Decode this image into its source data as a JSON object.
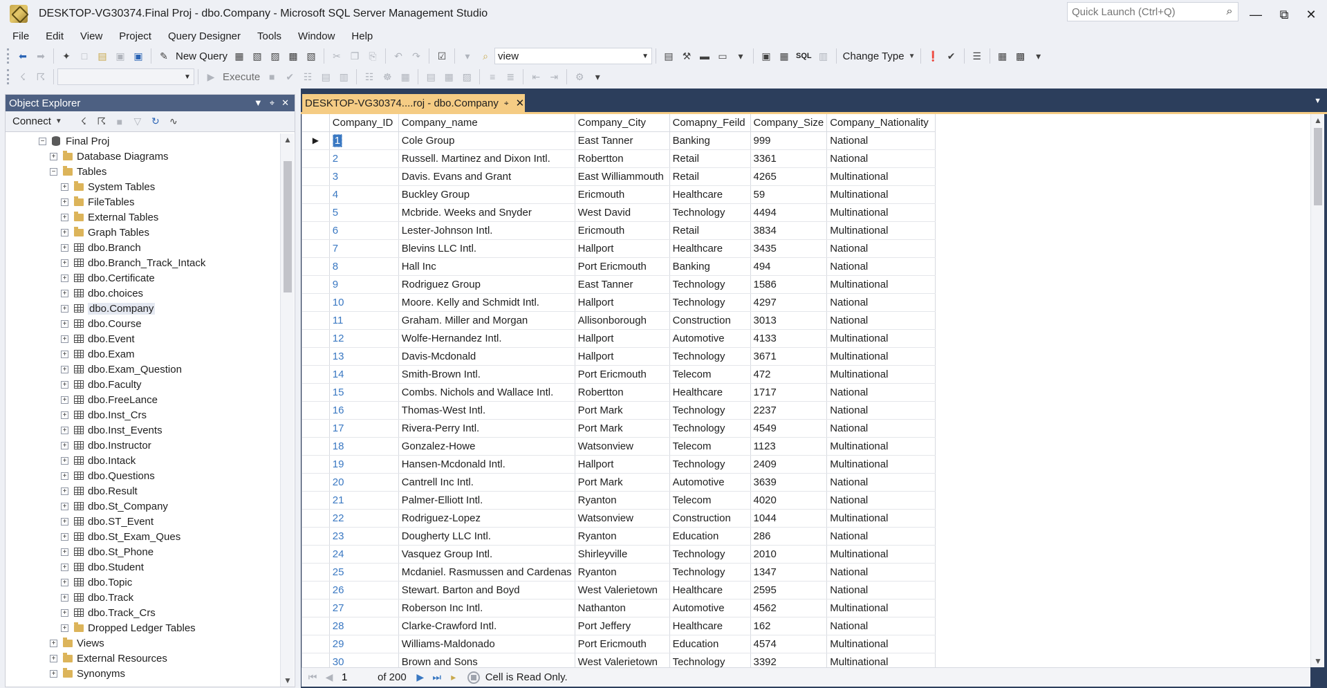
{
  "window": {
    "title": "DESKTOP-VG30374.Final Proj - dbo.Company - Microsoft SQL Server Management Studio",
    "quick_launch_placeholder": "Quick Launch (Ctrl+Q)"
  },
  "menu": [
    "File",
    "Edit",
    "View",
    "Project",
    "Query Designer",
    "Tools",
    "Window",
    "Help"
  ],
  "toolbar": {
    "new_query": "New Query",
    "search_combo_value": "view",
    "change_type": "Change Type",
    "execute": "Execute",
    "sql_label": "SQL"
  },
  "object_explorer": {
    "title": "Object Explorer",
    "connect_label": "Connect",
    "tree": [
      {
        "label": "Final Proj",
        "level": 0,
        "icon": "database-icon",
        "expanded": true
      },
      {
        "label": "Database Diagrams",
        "level": 1,
        "icon": "folder-icon",
        "expanded": false
      },
      {
        "label": "Tables",
        "level": 1,
        "icon": "folder-icon",
        "expanded": true
      },
      {
        "label": "System Tables",
        "level": 2,
        "icon": "folder-icon",
        "expanded": false
      },
      {
        "label": "FileTables",
        "level": 2,
        "icon": "folder-icon",
        "expanded": false
      },
      {
        "label": "External Tables",
        "level": 2,
        "icon": "folder-icon",
        "expanded": false
      },
      {
        "label": "Graph Tables",
        "level": 2,
        "icon": "folder-icon",
        "expanded": false
      },
      {
        "label": "dbo.Branch",
        "level": 2,
        "icon": "table-icon",
        "expanded": false
      },
      {
        "label": "dbo.Branch_Track_Intack",
        "level": 2,
        "icon": "table-icon",
        "expanded": false
      },
      {
        "label": "dbo.Certificate",
        "level": 2,
        "icon": "table-icon",
        "expanded": false
      },
      {
        "label": "dbo.choices",
        "level": 2,
        "icon": "table-icon",
        "expanded": false
      },
      {
        "label": "dbo.Company",
        "level": 2,
        "icon": "table-icon",
        "expanded": false,
        "selected": true
      },
      {
        "label": "dbo.Course",
        "level": 2,
        "icon": "table-icon",
        "expanded": false
      },
      {
        "label": "dbo.Event",
        "level": 2,
        "icon": "table-icon",
        "expanded": false
      },
      {
        "label": "dbo.Exam",
        "level": 2,
        "icon": "table-icon",
        "expanded": false
      },
      {
        "label": "dbo.Exam_Question",
        "level": 2,
        "icon": "table-icon",
        "expanded": false
      },
      {
        "label": "dbo.Faculty",
        "level": 2,
        "icon": "table-icon",
        "expanded": false
      },
      {
        "label": "dbo.FreeLance",
        "level": 2,
        "icon": "table-icon",
        "expanded": false
      },
      {
        "label": "dbo.Inst_Crs",
        "level": 2,
        "icon": "table-icon",
        "expanded": false
      },
      {
        "label": "dbo.Inst_Events",
        "level": 2,
        "icon": "table-icon",
        "expanded": false
      },
      {
        "label": "dbo.Instructor",
        "level": 2,
        "icon": "table-icon",
        "expanded": false
      },
      {
        "label": "dbo.Intack",
        "level": 2,
        "icon": "table-icon",
        "expanded": false
      },
      {
        "label": "dbo.Questions",
        "level": 2,
        "icon": "table-icon",
        "expanded": false
      },
      {
        "label": "dbo.Result",
        "level": 2,
        "icon": "table-icon",
        "expanded": false
      },
      {
        "label": "dbo.St_Company",
        "level": 2,
        "icon": "table-icon",
        "expanded": false
      },
      {
        "label": "dbo.ST_Event",
        "level": 2,
        "icon": "table-icon",
        "expanded": false
      },
      {
        "label": "dbo.St_Exam_Ques",
        "level": 2,
        "icon": "table-icon",
        "expanded": false
      },
      {
        "label": "dbo.St_Phone",
        "level": 2,
        "icon": "table-icon",
        "expanded": false
      },
      {
        "label": "dbo.Student",
        "level": 2,
        "icon": "table-icon",
        "expanded": false
      },
      {
        "label": "dbo.Topic",
        "level": 2,
        "icon": "table-icon",
        "expanded": false
      },
      {
        "label": "dbo.Track",
        "level": 2,
        "icon": "table-icon",
        "expanded": false
      },
      {
        "label": "dbo.Track_Crs",
        "level": 2,
        "icon": "table-icon",
        "expanded": false
      },
      {
        "label": "Dropped Ledger Tables",
        "level": 2,
        "icon": "folder-icon",
        "expanded": false
      },
      {
        "label": "Views",
        "level": 1,
        "icon": "folder-icon",
        "expanded": false
      },
      {
        "label": "External Resources",
        "level": 1,
        "icon": "folder-icon",
        "expanded": false
      },
      {
        "label": "Synonyms",
        "level": 1,
        "icon": "folder-icon",
        "expanded": false
      }
    ]
  },
  "document": {
    "tab_label": "DESKTOP-VG30374....roj - dbo.Company"
  },
  "grid": {
    "columns": [
      "Company_ID",
      "Company_name",
      "Company_City",
      "Comapny_Feild",
      "Company_Size",
      "Company_Nationality"
    ],
    "rows": [
      [
        "1",
        "Cole Group",
        "East Tanner",
        "Banking",
        "999",
        "National"
      ],
      [
        "2",
        "Russell. Martinez and Dixon Intl.",
        "Robertton",
        "Retail",
        "3361",
        "National"
      ],
      [
        "3",
        "Davis. Evans and Grant",
        "East Williammouth",
        "Retail",
        "4265",
        "Multinational"
      ],
      [
        "4",
        "Buckley Group",
        "Ericmouth",
        "Healthcare",
        "59",
        "Multinational"
      ],
      [
        "5",
        "Mcbride. Weeks and Snyder",
        "West David",
        "Technology",
        "4494",
        "Multinational"
      ],
      [
        "6",
        "Lester-Johnson Intl.",
        "Ericmouth",
        "Retail",
        "3834",
        "Multinational"
      ],
      [
        "7",
        "Blevins LLC Intl.",
        "Hallport",
        "Healthcare",
        "3435",
        "National"
      ],
      [
        "8",
        "Hall Inc",
        "Port Ericmouth",
        "Banking",
        "494",
        "National"
      ],
      [
        "9",
        "Rodriguez Group",
        "East Tanner",
        "Technology",
        "1586",
        "Multinational"
      ],
      [
        "10",
        "Moore. Kelly and Schmidt Intl.",
        "Hallport",
        "Technology",
        "4297",
        "National"
      ],
      [
        "11",
        "Graham. Miller and Morgan",
        "Allisonborough",
        "Construction",
        "3013",
        "National"
      ],
      [
        "12",
        "Wolfe-Hernandez Intl.",
        "Hallport",
        "Automotive",
        "4133",
        "Multinational"
      ],
      [
        "13",
        "Davis-Mcdonald",
        "Hallport",
        "Technology",
        "3671",
        "Multinational"
      ],
      [
        "14",
        "Smith-Brown Intl.",
        "Port Ericmouth",
        "Telecom",
        "472",
        "Multinational"
      ],
      [
        "15",
        "Combs. Nichols and Wallace Intl.",
        "Robertton",
        "Healthcare",
        "1717",
        "National"
      ],
      [
        "16",
        "Thomas-West Intl.",
        "Port Mark",
        "Technology",
        "2237",
        "National"
      ],
      [
        "17",
        "Rivera-Perry Intl.",
        "Port Mark",
        "Technology",
        "4549",
        "National"
      ],
      [
        "18",
        "Gonzalez-Howe",
        "Watsonview",
        "Telecom",
        "1123",
        "Multinational"
      ],
      [
        "19",
        "Hansen-Mcdonald Intl.",
        "Hallport",
        "Technology",
        "2409",
        "Multinational"
      ],
      [
        "20",
        "Cantrell Inc Intl.",
        "Port Mark",
        "Automotive",
        "3639",
        "National"
      ],
      [
        "21",
        "Palmer-Elliott Intl.",
        "Ryanton",
        "Telecom",
        "4020",
        "National"
      ],
      [
        "22",
        "Rodriguez-Lopez",
        "Watsonview",
        "Construction",
        "1044",
        "Multinational"
      ],
      [
        "23",
        "Dougherty LLC Intl.",
        "Ryanton",
        "Education",
        "286",
        "National"
      ],
      [
        "24",
        "Vasquez Group Intl.",
        "Shirleyville",
        "Technology",
        "2010",
        "Multinational"
      ],
      [
        "25",
        "Mcdaniel. Rasmussen and Cardenas",
        "Ryanton",
        "Technology",
        "1347",
        "National"
      ],
      [
        "26",
        "Stewart. Barton and Boyd",
        "West Valerietown",
        "Healthcare",
        "2595",
        "National"
      ],
      [
        "27",
        "Roberson Inc Intl.",
        "Nathanton",
        "Automotive",
        "4562",
        "Multinational"
      ],
      [
        "28",
        "Clarke-Crawford Intl.",
        "Port Jeffery",
        "Healthcare",
        "162",
        "National"
      ],
      [
        "29",
        "Williams-Maldonado",
        "Port Ericmouth",
        "Education",
        "4574",
        "Multinational"
      ],
      [
        "30",
        "Brown and Sons",
        "West Valerietown",
        "Technology",
        "3392",
        "Multinational"
      ]
    ]
  },
  "navigation": {
    "current_page": "1",
    "of_label": "of 200",
    "status": "Cell is Read Only."
  }
}
